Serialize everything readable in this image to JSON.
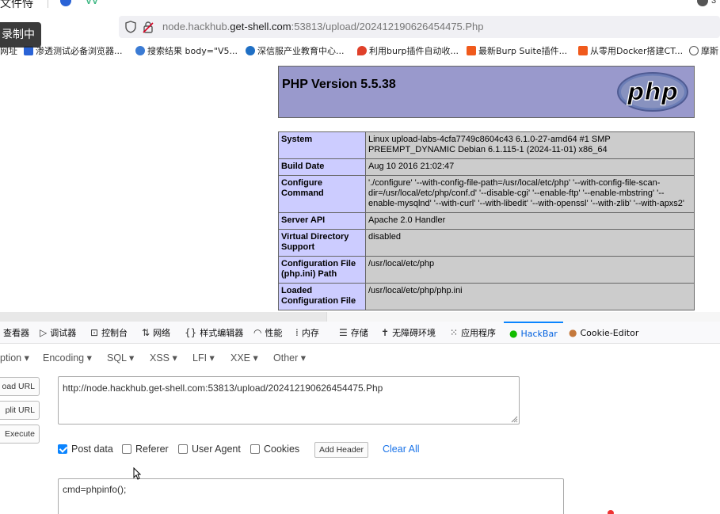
{
  "top_strip": {
    "fragment": "文件恃",
    "badge_count": "3"
  },
  "address_bar": {
    "url_prefix": "node.hackhub.",
    "url_host": "get-shell.com",
    "url_suffix": ":53813/upload/202412190626454475.Php"
  },
  "recording_badge": "录制中",
  "bookmarks": [
    {
      "label": "网址",
      "color": "#888888"
    },
    {
      "label": "渗透测试必备浏览器...",
      "color": "#2a63d6"
    },
    {
      "label": "搜索结果 body=\"V5...",
      "color": "#3b7bd4"
    },
    {
      "label": "深信服产业教育中心...",
      "color": "#1f6fc4"
    },
    {
      "label": "利用burp插件自动收...",
      "color": "#e0402a"
    },
    {
      "label": "最新Burp Suite插件...",
      "color": "#f05a1c"
    },
    {
      "label": "从零用Docker搭建CT...",
      "color": "#f05a1c"
    },
    {
      "label": "摩斯",
      "color": "#555555"
    }
  ],
  "phpinfo": {
    "version": "PHP Version 5.5.38",
    "logo_text": "php",
    "rows": [
      {
        "key": "System",
        "value": "Linux upload-labs-4cfa7749c8604c43 6.1.0-27-amd64 #1 SMP PREEMPT_DYNAMIC Debian 6.1.115-1 (2024-11-01) x86_64"
      },
      {
        "key": "Build Date",
        "value": "Aug 10 2016 21:02:47"
      },
      {
        "key": "Configure Command",
        "value": "'./configure' '--with-config-file-path=/usr/local/etc/php' '--with-config-file-scan-dir=/usr/local/etc/php/conf.d' '--disable-cgi' '--enable-ftp' '--enable-mbstring' '--enable-mysqlnd' '--with-curl' '--with-libedit' '--with-openssl' '--with-zlib' '--with-apxs2'"
      },
      {
        "key": "Server API",
        "value": "Apache 2.0 Handler"
      },
      {
        "key": "Virtual Directory Support",
        "value": "disabled"
      },
      {
        "key": "Configuration File (php.ini) Path",
        "value": "/usr/local/etc/php"
      },
      {
        "key": "Loaded Configuration File",
        "value": "/usr/local/etc/php/php.ini"
      }
    ]
  },
  "devtools_tabs": [
    {
      "label": "查看器",
      "icon": "inspector-icon"
    },
    {
      "label": "调试器",
      "icon": "debugger-icon"
    },
    {
      "label": "控制台",
      "icon": "console-icon"
    },
    {
      "label": "网络",
      "icon": "network-icon"
    },
    {
      "label": "样式编辑器",
      "icon": "style-editor-icon"
    },
    {
      "label": "性能",
      "icon": "performance-icon"
    },
    {
      "label": "内存",
      "icon": "memory-icon"
    },
    {
      "label": "存储",
      "icon": "storage-icon"
    },
    {
      "label": "无障碍环境",
      "icon": "accessibility-icon"
    },
    {
      "label": "应用程序",
      "icon": "application-icon"
    },
    {
      "label": "HackBar",
      "icon": "hackbar-icon"
    },
    {
      "label": "Cookie-Editor",
      "icon": "cookie-icon"
    }
  ],
  "hackbar": {
    "menus": [
      "ption ▾",
      "Encoding ▾",
      "SQL ▾",
      "XSS ▾",
      "LFI ▾",
      "XXE ▾",
      "Other ▾"
    ],
    "buttons": {
      "load": "oad URL",
      "split": "plit URL",
      "execute": "Execute"
    },
    "url_value": "http://node.hackhub.get-shell.com:53813/upload/202412190626454475.Php",
    "options": [
      {
        "label": "Post data",
        "checked": true
      },
      {
        "label": "Referer",
        "checked": false
      },
      {
        "label": "User Agent",
        "checked": false
      },
      {
        "label": "Cookies",
        "checked": false
      }
    ],
    "add_header": "Add Header",
    "clear_all": "Clear All",
    "post_value": "cmd=phpinfo();"
  }
}
